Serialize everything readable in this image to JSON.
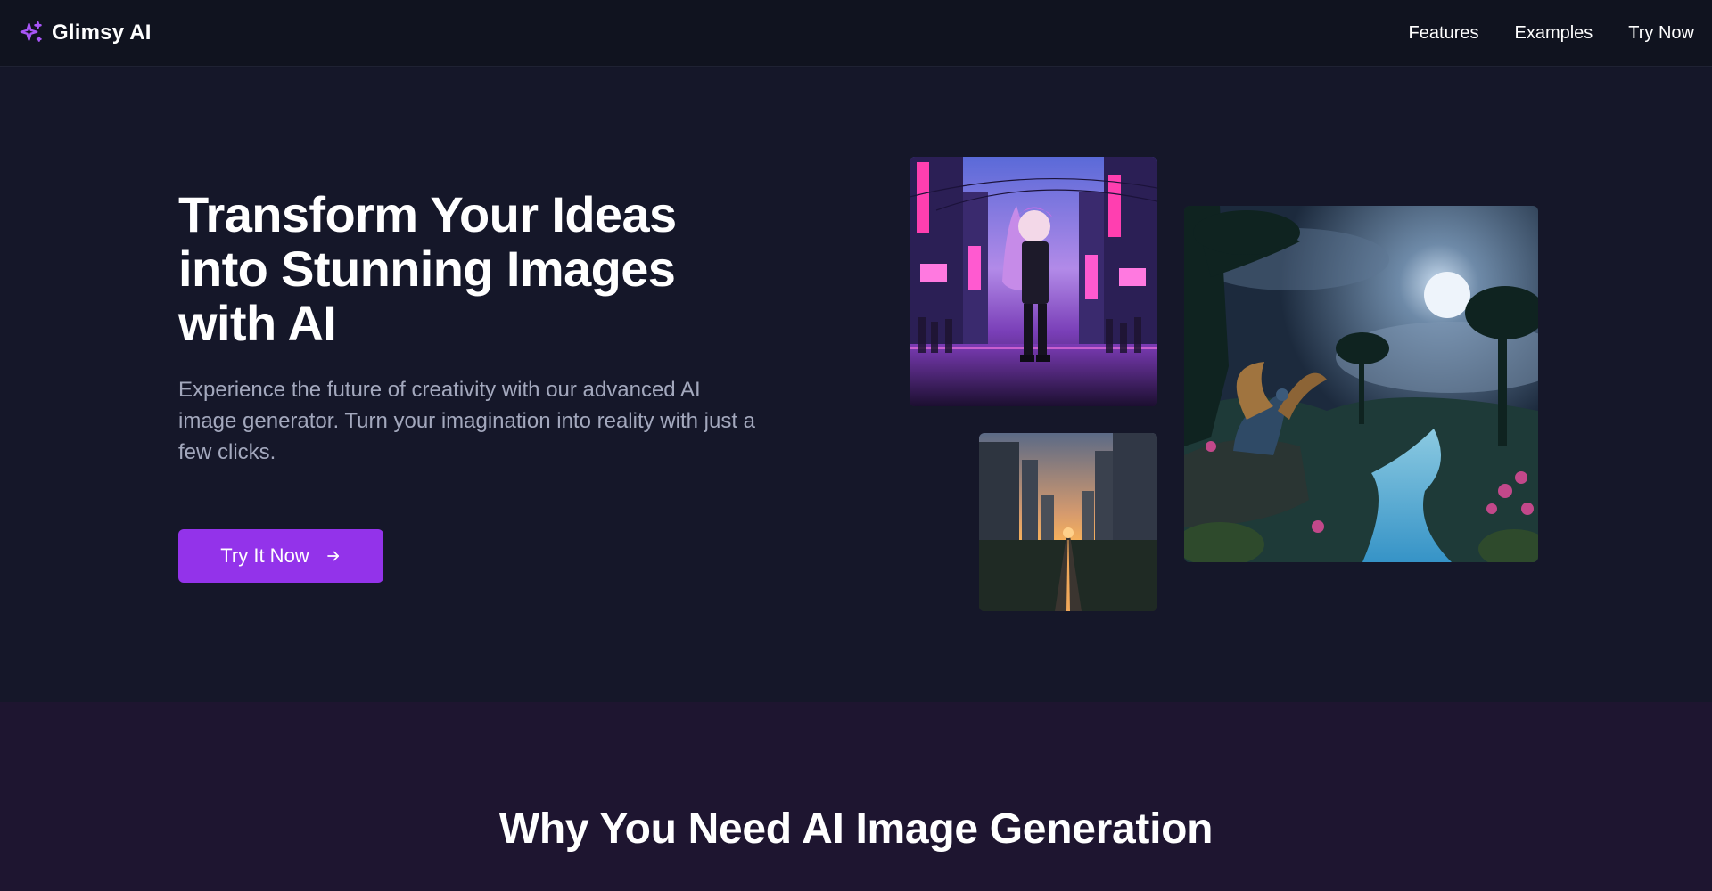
{
  "nav": {
    "brand": "Glimsy AI",
    "links": [
      "Features",
      "Examples",
      "Try Now"
    ]
  },
  "hero": {
    "title": "Transform Your Ideas into Stunning Images with AI",
    "subtitle": "Experience the future of creativity with our advanced AI image generator. Turn your imagination into reality with just a few clicks.",
    "cta_label": "Try It Now"
  },
  "gallery": [
    {
      "name": "anime-neon-street-image"
    },
    {
      "name": "city-sunset-image"
    },
    {
      "name": "dragon-forest-image"
    }
  ],
  "why": {
    "title": "Why You Need AI Image Generation"
  },
  "colors": {
    "accent": "#9333ea",
    "nav_bg": "#10131f",
    "hero_bg": "#151729",
    "section_bg": "#1e1530",
    "muted_text": "#a3a8bd"
  },
  "icons": {
    "brand": "sparkles-icon",
    "cta": "arrow-right-icon"
  }
}
